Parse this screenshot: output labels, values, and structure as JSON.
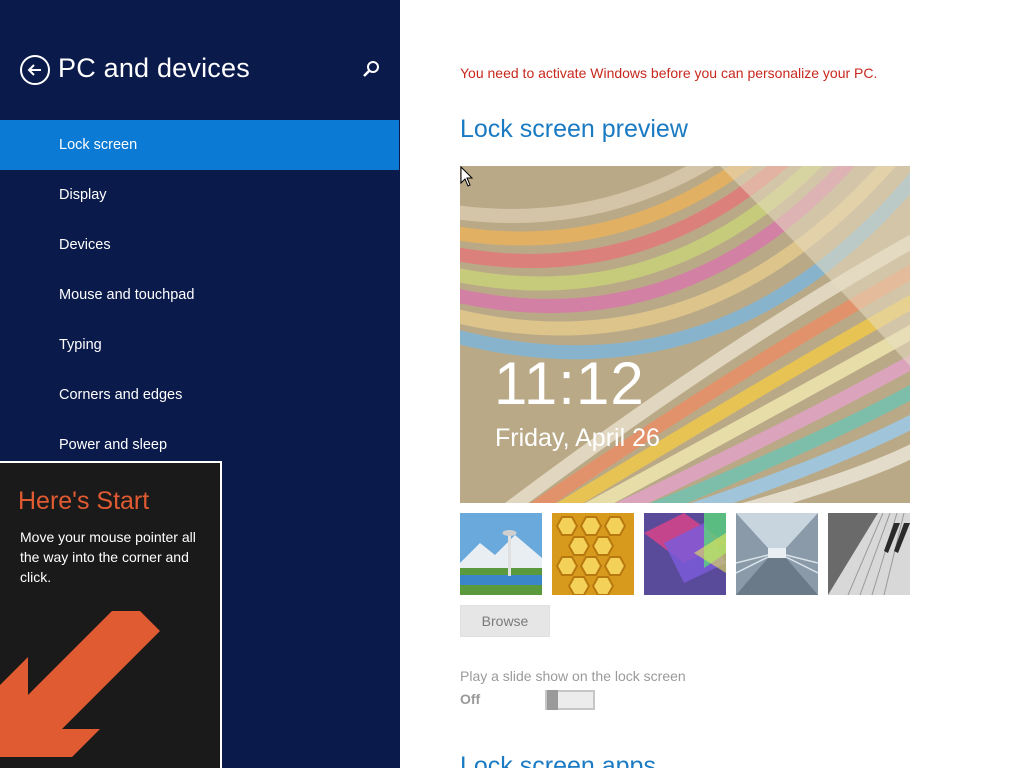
{
  "window": {
    "title": "PC and devices"
  },
  "sidebar": {
    "back_icon": "back-arrow-icon",
    "search_icon": "search-icon",
    "items": [
      {
        "label": "Lock screen",
        "active": true
      },
      {
        "label": "Display",
        "active": false
      },
      {
        "label": "Devices",
        "active": false
      },
      {
        "label": "Mouse and touchpad",
        "active": false
      },
      {
        "label": "Typing",
        "active": false
      },
      {
        "label": "Corners and edges",
        "active": false
      },
      {
        "label": "Power and sleep",
        "active": false
      }
    ]
  },
  "start_tip": {
    "title": "Here's Start",
    "text": "Move your mouse pointer all the way into the corner and click."
  },
  "main": {
    "activation_message": "You need to activate Windows before you can personalize your PC.",
    "preview_title": "Lock screen preview",
    "preview": {
      "time": "11:12",
      "date": "Friday, April 26"
    },
    "thumbnails": [
      "landscape-thumbnail",
      "honeycomb-thumbnail",
      "geometric-thumbnail",
      "tunnel-thumbnail",
      "piano-thumbnail"
    ],
    "browse_label": "Browse",
    "slideshow_label": "Play a slide show on the lock screen",
    "slideshow_state": "Off",
    "apps_title": "Lock screen apps"
  },
  "colors": {
    "sidebar_bg": "#0a1a4a",
    "active_item": "#0a7ad4",
    "accent_blue": "#1a7ac2",
    "warning_red": "#c8281e",
    "tip_orange": "#e05a32"
  }
}
